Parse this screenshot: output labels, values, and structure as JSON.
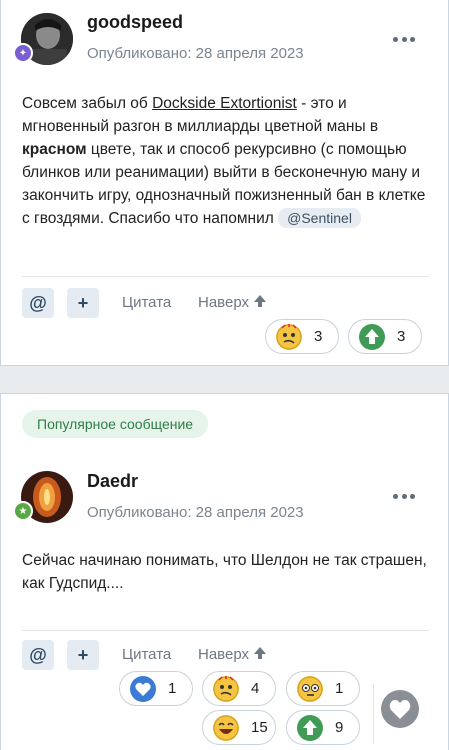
{
  "post1": {
    "author": "goodspeed",
    "date": "Опубликовано: 28 апреля 2023",
    "text_a": "Совсем забыл об ",
    "link": "Dockside Extortionist",
    "text_b": " - это и мгновенный разгон в миллиарды цветной маны в ",
    "bold": "красном",
    "text_c": " цвете, так и способ рекурсивно (с помощью блинков или реанимации) выйти в бесконечную ману и закончить игру, однозначный пожизненный бан в клетке с гвоздями. Спасибо что напомнил ",
    "mention": "@Sentinel",
    "actions": {
      "mention_btn": "@",
      "plus_btn": "+",
      "quote": "Цитата",
      "top": "Наверх"
    },
    "reactions": [
      {
        "icon": "confused-face-icon",
        "count": "3"
      },
      {
        "icon": "upvote-icon",
        "count": "3"
      }
    ]
  },
  "post2": {
    "badge": "Популярное сообщение",
    "author": "Daedr",
    "date": "Опубликовано: 28 апреля 2023",
    "text": "Сейчас начинаю понимать, что Шелдон не так страшен, как Гудспид....",
    "actions": {
      "mention_btn": "@",
      "plus_btn": "+",
      "quote": "Цитата",
      "top": "Наверх"
    },
    "reactions": [
      {
        "icon": "heart-icon",
        "count": "1"
      },
      {
        "icon": "confused-face-icon",
        "count": "4"
      },
      {
        "icon": "thinking-face-icon",
        "count": "1"
      },
      {
        "icon": "laughing-face-icon",
        "count": "15"
      },
      {
        "icon": "upvote-icon",
        "count": "9"
      }
    ]
  },
  "colors": {
    "accent": "#2e4a62",
    "green": "#3f9b56",
    "heart_blue": "#3b7bd4",
    "emoji_yellow": "#f5c542"
  }
}
